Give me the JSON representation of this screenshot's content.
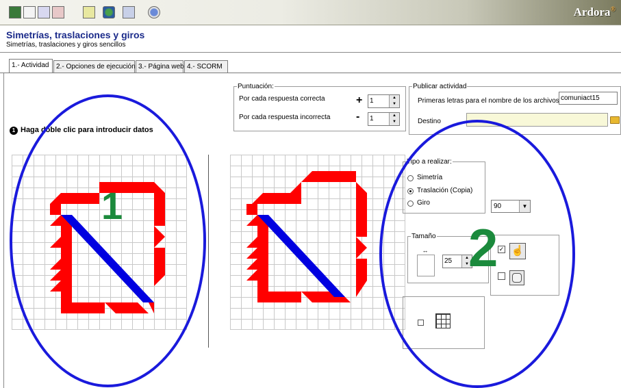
{
  "app": {
    "brand": "Ardora",
    "brand_mark": "®"
  },
  "header": {
    "title": "Simetrías, traslaciones y giros",
    "subtitle": "Simetrías, traslaciones y giros sencillos"
  },
  "tabs": [
    {
      "label": "1.- Actividad",
      "active": true
    },
    {
      "label": "2.- Opciones de ejecución",
      "active": false
    },
    {
      "label": "3.- Página web",
      "active": false
    },
    {
      "label": "4.- SCORM",
      "active": false
    }
  ],
  "instruction": {
    "icon": "info-bullet-icon",
    "text": "Haga doble clic para introducir datos"
  },
  "puntuacion": {
    "legend": "Puntuación:",
    "correct_label": "Por cada respuesta correcta",
    "correct_sign": "+",
    "correct_value": "1",
    "incorrect_label": "Por cada respuesta incorrecta",
    "incorrect_sign": "-",
    "incorrect_value": "1"
  },
  "publicar": {
    "legend": "Publicar actividad",
    "prefix_label": "Primeras letras para el nombre de los archivos",
    "prefix_value": "comuniact15",
    "destino_label": "Destino",
    "destino_value": ""
  },
  "tipo": {
    "legend": "Tipo a realizar:",
    "options": [
      {
        "label": "Simetría",
        "selected": false
      },
      {
        "label": "Traslación (Copia)",
        "selected": true
      },
      {
        "label": "Giro",
        "selected": false
      }
    ],
    "angle_value": "90"
  },
  "tamano": {
    "legend": "Tamaño",
    "value": "25"
  },
  "annotations": {
    "left_number": "1",
    "right_number": "2"
  },
  "colors": {
    "red": "#ff0000",
    "blue": "#0000e0",
    "ellipse": "#1a1adc",
    "number": "#1b8a3c",
    "title": "#1a2a8a"
  }
}
